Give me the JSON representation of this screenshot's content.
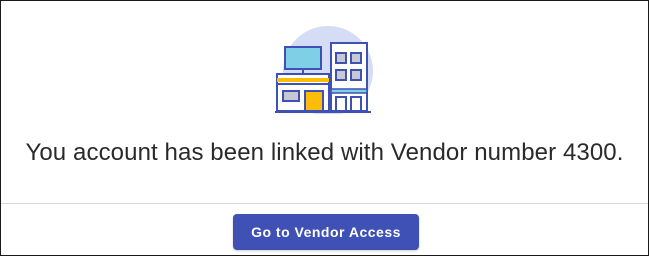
{
  "dialog": {
    "illustration_icon": "vendor-building-icon",
    "message": "You account has been linked with Vendor number 4300.",
    "primary_button_label": "Go to Vendor Access"
  },
  "colors": {
    "accent": "#3f51b5",
    "illustration_stroke": "#3f51b5",
    "illustration_circle": "#d4dcf6",
    "illustration_screen": "#7fd0e6",
    "illustration_highlight": "#fbbd08",
    "illustration_window": "#c8c8d2"
  }
}
